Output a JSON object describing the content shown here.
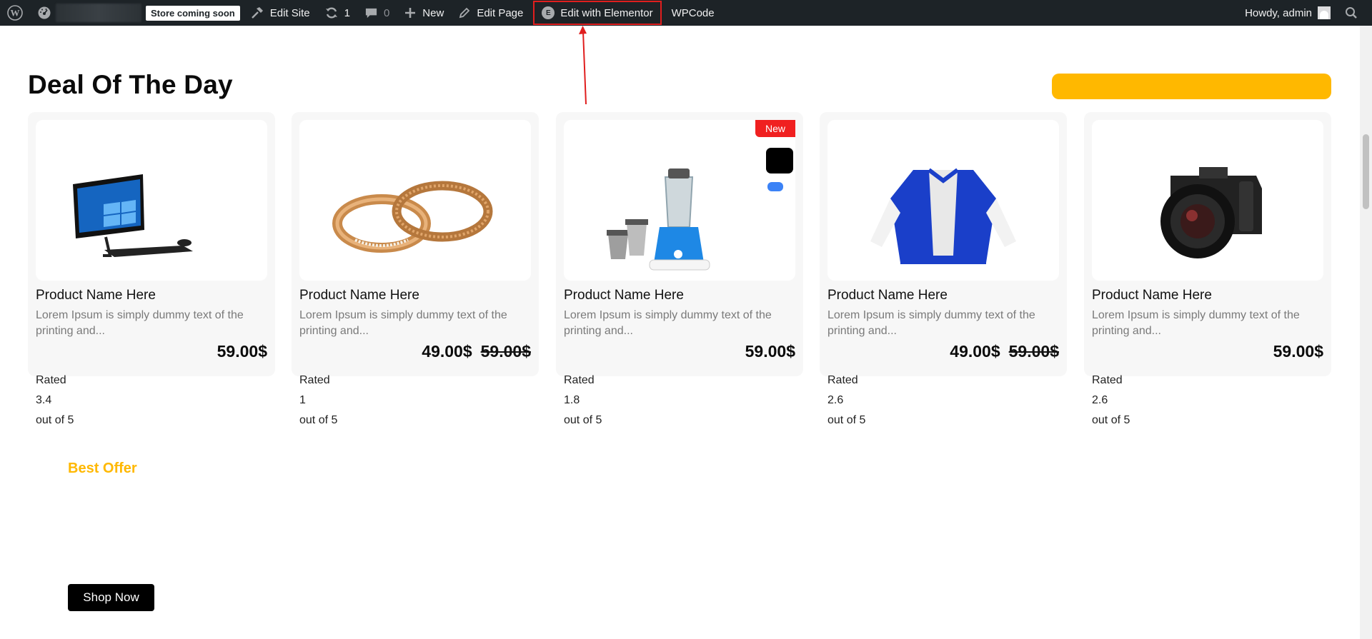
{
  "adminbar": {
    "coming_soon": "Store coming soon",
    "edit_site": "Edit Site",
    "updates_count": "1",
    "comments_count": "0",
    "new_label": "New",
    "edit_page": "Edit Page",
    "edit_elementor": "Edit with Elementor",
    "wpcode": "WPCode",
    "howdy": "Howdy, admin"
  },
  "section": {
    "title": "Deal Of The Day",
    "best_offer": "Best Offer",
    "shop_now": "Shop Now"
  },
  "products": [
    {
      "name": "Product Name Here",
      "desc": "Lorem Ipsum is simply dummy text of the printing and...",
      "price": "59.00$",
      "old_price": "",
      "rated_label": "Rated",
      "rating": "3.4",
      "out_of": "out of 5",
      "image": "all-in-one-computer-icon"
    },
    {
      "name": "Product Name Here",
      "desc": "Lorem Ipsum is simply dummy text of the printing and...",
      "price": "49.00$",
      "old_price": "59.00$",
      "rated_label": "Rated",
      "rating": "1",
      "out_of": "out of 5",
      "image": "gold-rings-icon"
    },
    {
      "name": "Product Name Here",
      "desc": "Lorem Ipsum is simply dummy text of the printing and...",
      "price": "59.00$",
      "old_price": "",
      "rated_label": "Rated",
      "rating": "1.8",
      "out_of": "out of 5",
      "image": "mixer-grinder-icon",
      "badge": "New"
    },
    {
      "name": "Product Name Here",
      "desc": "Lorem Ipsum is simply dummy text of the printing and...",
      "price": "49.00$",
      "old_price": "59.00$",
      "rated_label": "Rated",
      "rating": "2.6",
      "out_of": "out of 5",
      "image": "varsity-jacket-icon"
    },
    {
      "name": "Product Name Here",
      "desc": "Lorem Ipsum is simply dummy text of the printing and...",
      "price": "59.00$",
      "old_price": "",
      "rated_label": "Rated",
      "rating": "2.6",
      "out_of": "out of 5",
      "image": "camera-icon"
    }
  ],
  "colors": {
    "adminbar_bg": "#1d2327",
    "accent_yellow": "#ffb800",
    "badge_red": "#f02020",
    "annotation_red": "#e01e1e"
  }
}
